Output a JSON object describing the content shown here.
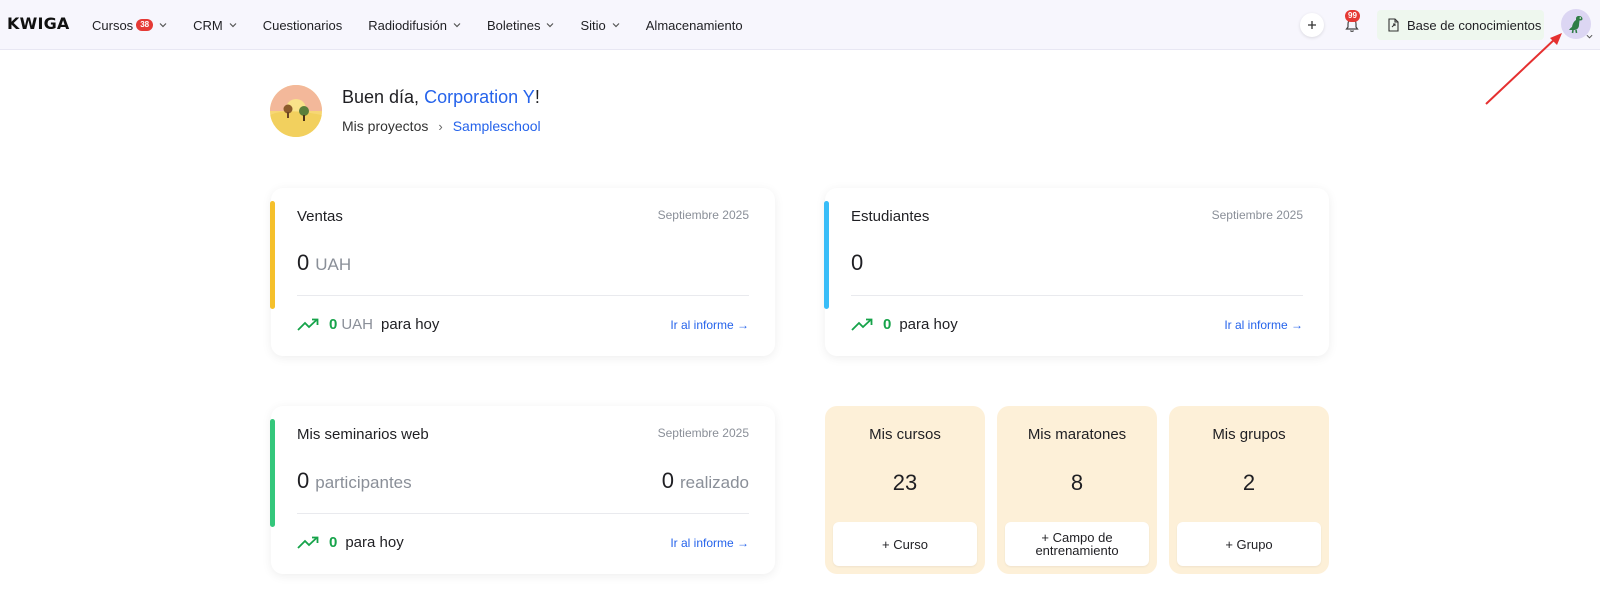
{
  "app": {
    "logo": "KWIGA"
  },
  "nav": {
    "items": [
      {
        "label": "Cursos",
        "badge": "38",
        "dropdown": true
      },
      {
        "label": "CRM",
        "dropdown": true
      },
      {
        "label": "Cuestionarios",
        "dropdown": false
      },
      {
        "label": "Radiodifusión",
        "dropdown": true
      },
      {
        "label": "Boletines",
        "dropdown": true
      },
      {
        "label": "Sitio",
        "dropdown": true
      },
      {
        "label": "Almacenamiento",
        "dropdown": false
      }
    ],
    "plus_icon": "plus-icon",
    "notifications_badge": "99",
    "knowledge_base_label": "Base de conocimientos"
  },
  "greeting": {
    "prefix": "Buen día, ",
    "org": "Corporation Y",
    "suffix": "!",
    "breadcrumb_root": "Mis proyectos",
    "breadcrumb_sep": "›",
    "breadcrumb_current": "Sampleschool"
  },
  "cards": {
    "sales": {
      "title": "Ventas",
      "period": "Septiembre 2025",
      "value": "0",
      "unit": "UAH",
      "today_value": "0",
      "today_unit": "UAH",
      "today_label": "para hoy",
      "report": "Ir al informe →",
      "accent": "#f5c02b"
    },
    "students": {
      "title": "Estudiantes",
      "period": "Septiembre 2025",
      "value": "0",
      "today_value": "0",
      "today_label": "para hoy",
      "report": "Ir al informe →",
      "accent": "#38bdf8"
    },
    "webinars": {
      "title": "Mis seminarios web",
      "period": "Septiembre 2025",
      "value": "0",
      "unit": "participantes",
      "value_right": "0",
      "unit_right": "realizado",
      "today_value": "0",
      "today_label": "para hoy",
      "report": "Ir al informe →",
      "accent": "#34c77b"
    }
  },
  "minis": [
    {
      "title": "Mis cursos",
      "count": "23",
      "button": "+ Curso"
    },
    {
      "title": "Mis maratones",
      "count": "8",
      "button": "+ Campo de entrenamiento"
    },
    {
      "title": "Mis grupos",
      "count": "2",
      "button": "+ Grupo"
    }
  ],
  "colors": {
    "brand_blue": "#2563eb",
    "positive": "#16a34a",
    "mini_bg": "#fdf0d8"
  }
}
